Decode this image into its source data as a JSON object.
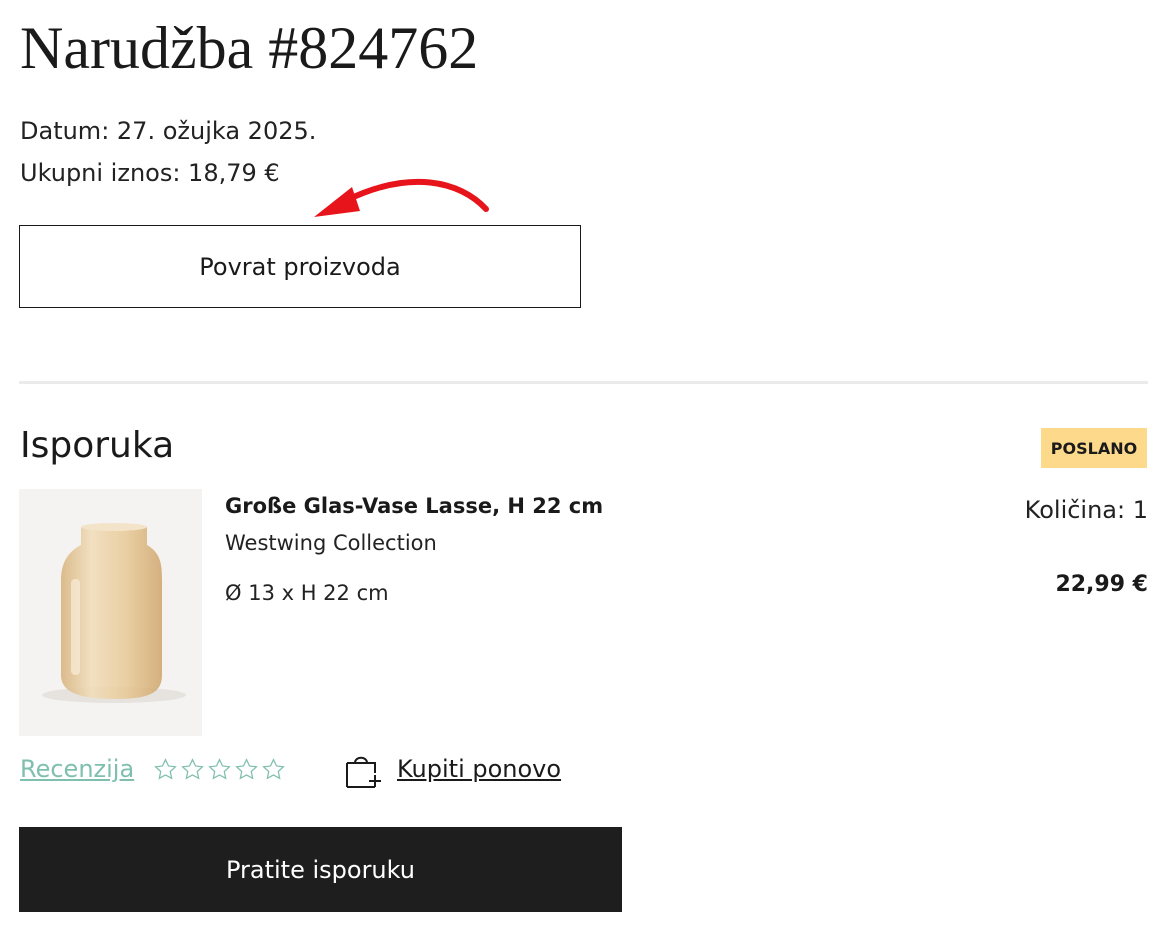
{
  "order": {
    "title": "Narudžba #824762",
    "date_line": "Datum: 27. ožujka 2025.",
    "total_line": "Ukupni iznos: 18,79 €",
    "return_button_label": "Povrat proizvoda",
    "annotation_color": "#e8141b"
  },
  "shipment": {
    "section_title": "Isporuka",
    "status_badge": "POSLANO",
    "status_color": "#fdd98c",
    "item": {
      "name": "Große Glas-Vase Lasse, H 22 cm",
      "brand": "Westwing Collection",
      "dimensions": "Ø 13 x H 22 cm",
      "quantity_line": "Količina: 1",
      "price": "22,99 €",
      "image_icon": "amber-glass-vase"
    },
    "review": {
      "link_label": "Recenzija",
      "rating": 0,
      "max_rating": 5,
      "link_color": "#7fbfae"
    },
    "buy_again": {
      "label": "Kupiti ponovo",
      "icon": "bag-plus-icon"
    },
    "track_button_label": "Pratite isporuku"
  }
}
